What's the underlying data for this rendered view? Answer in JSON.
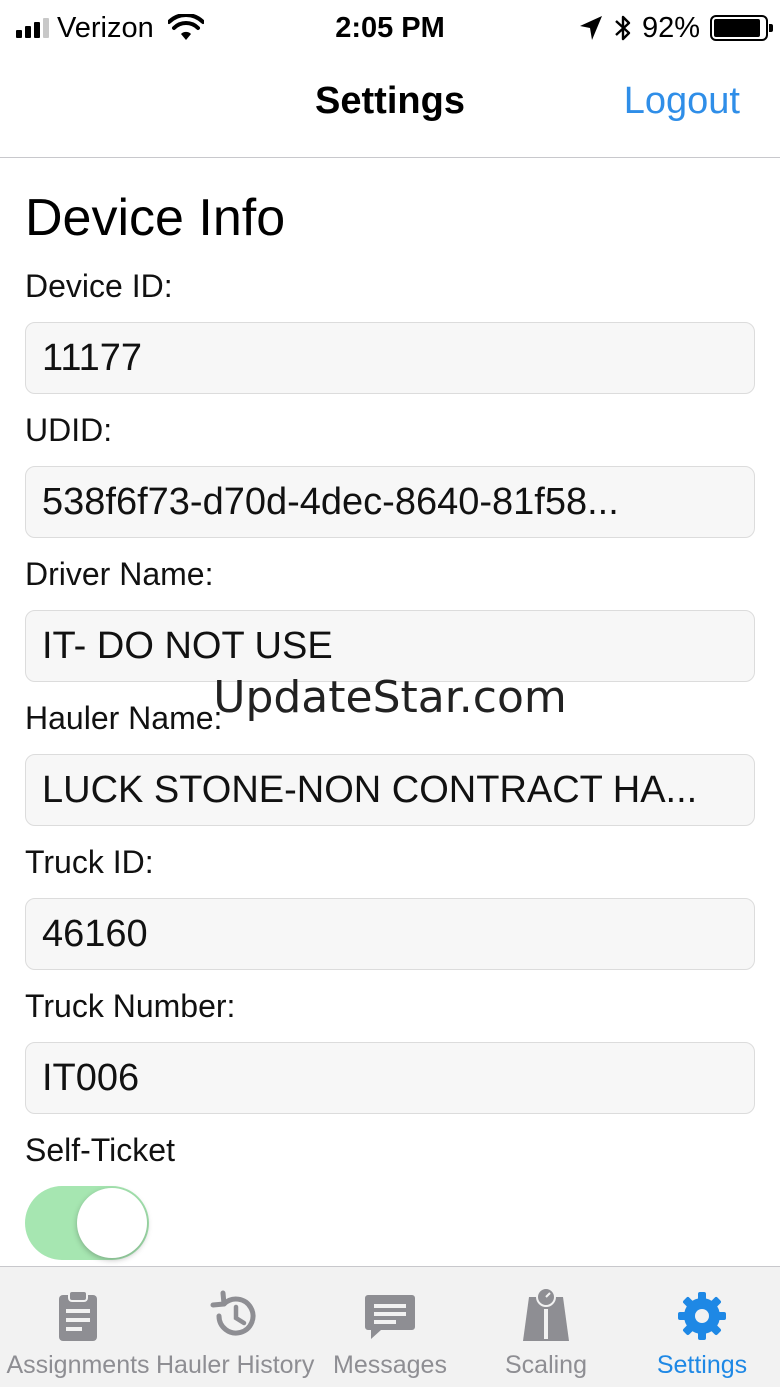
{
  "status_bar": {
    "carrier": "Verizon",
    "time": "2:05 PM",
    "battery_percent": "92%",
    "battery_level": 0.92,
    "signal_bars": 3
  },
  "nav": {
    "title": "Settings",
    "logout_label": "Logout"
  },
  "section": {
    "title": "Device Info"
  },
  "fields": {
    "device_id": {
      "label": "Device ID:",
      "value": "11177"
    },
    "udid": {
      "label": "UDID:",
      "value": "538f6f73-d70d-4dec-8640-81f58..."
    },
    "driver_name": {
      "label": "Driver Name:",
      "value": "IT- DO NOT USE"
    },
    "hauler_name": {
      "label": "Hauler Name:",
      "value": "LUCK STONE-NON CONTRACT HA..."
    },
    "truck_id": {
      "label": "Truck ID:",
      "value": "46160"
    },
    "truck_number": {
      "label": "Truck Number:",
      "value": "IT006"
    }
  },
  "self_ticket": {
    "label": "Self-Ticket",
    "enabled": true
  },
  "watermark": "UpdateStar.com",
  "tabs": [
    {
      "label": "Assignments",
      "icon": "clipboard-icon",
      "active": false
    },
    {
      "label": "Hauler History",
      "icon": "history-icon",
      "active": false
    },
    {
      "label": "Messages",
      "icon": "message-icon",
      "active": false
    },
    {
      "label": "Scaling",
      "icon": "scale-icon",
      "active": false
    },
    {
      "label": "Settings",
      "icon": "gear-icon",
      "active": true
    }
  ],
  "colors": {
    "accent": "#2f8ee8",
    "active_tab": "#1e88e5",
    "inactive_tab": "#8e8e93",
    "toggle_on": "#a6e6b1"
  }
}
